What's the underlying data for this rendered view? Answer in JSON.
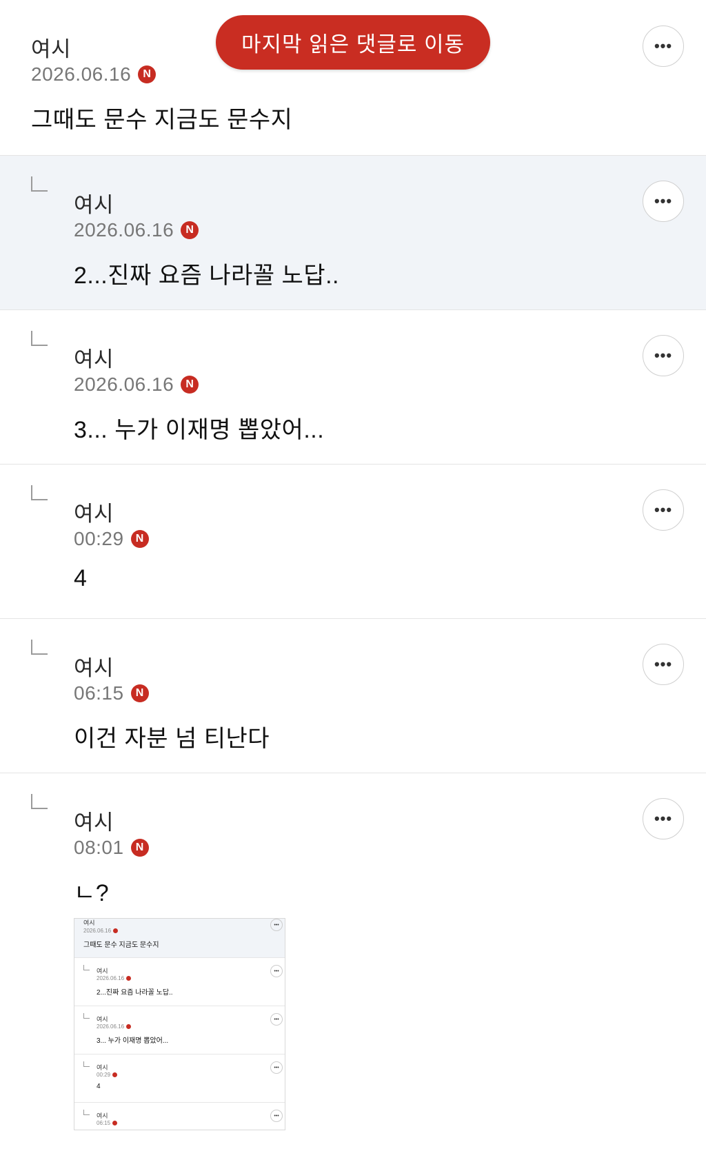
{
  "jump_button": {
    "label": "마지막 읽은 댓글로 이동"
  },
  "more_symbol": "•••",
  "badge_letter": "N",
  "comments": [
    {
      "author": "여시",
      "date": "2026.06.16",
      "text": "그때도 문수 지금도 문수지",
      "is_reply": false,
      "highlighted": false
    },
    {
      "author": "여시",
      "date": "2026.06.16",
      "text": "2...진짜 요즘 나라꼴 노답..",
      "is_reply": true,
      "highlighted": true
    },
    {
      "author": "여시",
      "date": "2026.06.16",
      "text": "3... 누가 이재명 뽑았어...",
      "is_reply": true,
      "highlighted": false
    },
    {
      "author": "여시",
      "date": "00:29",
      "text": "4",
      "is_reply": true,
      "highlighted": false
    },
    {
      "author": "여시",
      "date": "06:15",
      "text": "이건 자분 넘 티난다",
      "is_reply": true,
      "highlighted": false
    },
    {
      "author": "여시",
      "date": "08:01",
      "text": "ㄴ?",
      "is_reply": true,
      "highlighted": false
    }
  ],
  "attached_image": {
    "rows": [
      {
        "author": "여시",
        "date": "2026.06.16",
        "text": "그때도 문수 지금도 문수지"
      },
      {
        "author": "여시",
        "date": "2026.06.16",
        "text": "2...진짜 요즘 나라꼴 노답.."
      },
      {
        "author": "여시",
        "date": "2026.06.16",
        "text": "3... 누가 이재명 뽑았어..."
      },
      {
        "author": "여시",
        "date": "00:29",
        "text": "4"
      },
      {
        "author": "여시",
        "date": "06:15",
        "text": ""
      }
    ]
  },
  "colors": {
    "accent_red": "#c92d22",
    "highlight_bg": "#f1f4f8",
    "divider": "#e4e4e4"
  }
}
